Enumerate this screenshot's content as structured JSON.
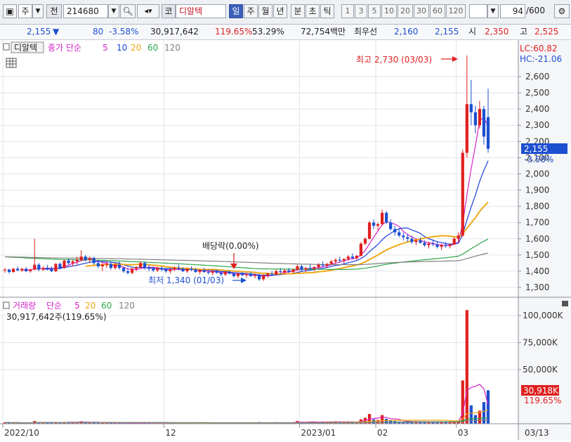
{
  "toolbar": {
    "period_label": "주",
    "jeon_label": "전",
    "code": "214680",
    "market_badge": "코",
    "stock_name": "디알텍",
    "period_tabs": [
      "일",
      "주",
      "월",
      "년",
      "분",
      "초",
      "틱"
    ],
    "active_tab": "일",
    "numbers": [
      "1",
      "3",
      "5",
      "10",
      "20",
      "30",
      "60",
      "120"
    ],
    "count_value": "94",
    "count_total": "/600",
    "icons": [
      "window-icon",
      "dropdown-icon",
      "search-icon",
      "speaker-icon",
      "chart-settings-icon"
    ]
  },
  "info": {
    "price": "2,155",
    "change_arrow": "▼",
    "change": "80",
    "change_rate": "-3.58%",
    "volume": "30,917,642",
    "volume_rate": "119.65%",
    "turnover": "53.29%",
    "amount": "72,754백만",
    "best_label": "최우선",
    "best_ask": "2,160",
    "best_bid": "2,155",
    "open_label": "시",
    "open": "2,350",
    "high_label": "고",
    "high": "2,525"
  },
  "price_panel": {
    "name_tag": "디알텍",
    "legend_prefix": "종가 단순",
    "ma_labels": [
      "5",
      "10",
      "20",
      "60",
      "120"
    ],
    "ma_colors": [
      "#d622c8",
      "#1a3fd6",
      "#f0a818",
      "#2ea64a",
      "#808080"
    ],
    "lc": "LC:60.82",
    "hc": "HC:-21.06",
    "high_annotation": "최고 2,730 (03/03)",
    "low_annotation": "최저 1,340 (01/03)",
    "dividend_annotation": "배당락(0.00%)",
    "current_price_tag": "2,155",
    "current_change_tag": "-3.58%"
  },
  "volume_panel": {
    "legend_title": "거래량",
    "legend_prefix": "단순",
    "ma_labels": [
      "5",
      "20",
      "60",
      "120"
    ],
    "ma_colors": [
      "#d622c8",
      "#f0a818",
      "#2ea64a",
      "#808080"
    ],
    "sub_label": "30,917,642주(119.65%)",
    "current_volume_tag": "30,918K",
    "current_rate_tag": "119.65%"
  },
  "x_axis": {
    "labels": [
      "2022/10",
      "12",
      "2023/01",
      "02",
      "03",
      "03/13"
    ]
  },
  "chart_data": {
    "type": "candlestick",
    "price_axis": {
      "ylim": [
        1250,
        2780
      ],
      "ticks": [
        1300,
        1400,
        1500,
        1600,
        1700,
        1800,
        1900,
        2000,
        2100,
        2200,
        2300,
        2400,
        2500,
        2600
      ]
    },
    "volume_axis": {
      "ylim": [
        0,
        110000
      ],
      "ticks": [
        "100,000K",
        "75,000K",
        "50,000K"
      ],
      "tick_values": [
        100000,
        75000,
        50000
      ]
    },
    "candles": [
      [
        1405,
        1420,
        1390,
        1410
      ],
      [
        1410,
        1415,
        1385,
        1395
      ],
      [
        1395,
        1420,
        1390,
        1415
      ],
      [
        1415,
        1430,
        1400,
        1405
      ],
      [
        1405,
        1420,
        1395,
        1415
      ],
      [
        1415,
        1425,
        1395,
        1400
      ],
      [
        1400,
        1415,
        1390,
        1410
      ],
      [
        1410,
        1600,
        1405,
        1440
      ],
      [
        1440,
        1450,
        1400,
        1410
      ],
      [
        1410,
        1430,
        1400,
        1420
      ],
      [
        1420,
        1440,
        1405,
        1415
      ],
      [
        1415,
        1430,
        1395,
        1400
      ],
      [
        1400,
        1450,
        1395,
        1445
      ],
      [
        1445,
        1455,
        1410,
        1420
      ],
      [
        1420,
        1470,
        1415,
        1465
      ],
      [
        1465,
        1480,
        1440,
        1450
      ],
      [
        1450,
        1470,
        1430,
        1460
      ],
      [
        1460,
        1490,
        1440,
        1470
      ],
      [
        1470,
        1530,
        1460,
        1490
      ],
      [
        1490,
        1500,
        1460,
        1470
      ],
      [
        1470,
        1490,
        1450,
        1480
      ],
      [
        1480,
        1490,
        1440,
        1450
      ],
      [
        1450,
        1470,
        1420,
        1430
      ],
      [
        1430,
        1450,
        1400,
        1440
      ],
      [
        1440,
        1460,
        1420,
        1445
      ],
      [
        1445,
        1460,
        1410,
        1420
      ],
      [
        1420,
        1450,
        1410,
        1440
      ],
      [
        1440,
        1460,
        1410,
        1420
      ],
      [
        1420,
        1430,
        1390,
        1400
      ],
      [
        1400,
        1420,
        1380,
        1390
      ],
      [
        1390,
        1420,
        1380,
        1415
      ],
      [
        1415,
        1430,
        1400,
        1425
      ],
      [
        1425,
        1460,
        1415,
        1450
      ],
      [
        1450,
        1460,
        1410,
        1420
      ],
      [
        1420,
        1440,
        1400,
        1415
      ],
      [
        1415,
        1430,
        1395,
        1405
      ],
      [
        1405,
        1425,
        1395,
        1420
      ],
      [
        1420,
        1430,
        1400,
        1410
      ],
      [
        1410,
        1420,
        1390,
        1400
      ],
      [
        1400,
        1415,
        1385,
        1410
      ],
      [
        1410,
        1430,
        1400,
        1420
      ],
      [
        1420,
        1440,
        1405,
        1415
      ],
      [
        1415,
        1425,
        1395,
        1400
      ],
      [
        1400,
        1420,
        1390,
        1415
      ],
      [
        1415,
        1430,
        1400,
        1410
      ],
      [
        1410,
        1420,
        1390,
        1395
      ],
      [
        1395,
        1410,
        1380,
        1405
      ],
      [
        1405,
        1420,
        1390,
        1395
      ],
      [
        1395,
        1410,
        1380,
        1390
      ],
      [
        1390,
        1405,
        1375,
        1400
      ],
      [
        1400,
        1410,
        1385,
        1390
      ],
      [
        1390,
        1400,
        1370,
        1380
      ],
      [
        1380,
        1400,
        1370,
        1395
      ],
      [
        1395,
        1405,
        1380,
        1385
      ],
      [
        1385,
        1395,
        1360,
        1370
      ],
      [
        1370,
        1390,
        1355,
        1385
      ],
      [
        1385,
        1395,
        1370,
        1375
      ],
      [
        1375,
        1390,
        1360,
        1380
      ],
      [
        1380,
        1395,
        1365,
        1370
      ],
      [
        1370,
        1385,
        1355,
        1375
      ],
      [
        1375,
        1385,
        1340,
        1350
      ],
      [
        1350,
        1380,
        1340,
        1375
      ],
      [
        1375,
        1390,
        1360,
        1385
      ],
      [
        1385,
        1400,
        1370,
        1380
      ],
      [
        1380,
        1410,
        1375,
        1400
      ],
      [
        1400,
        1420,
        1385,
        1395
      ],
      [
        1395,
        1410,
        1380,
        1405
      ],
      [
        1405,
        1420,
        1390,
        1395
      ],
      [
        1395,
        1415,
        1385,
        1410
      ],
      [
        1410,
        1440,
        1405,
        1430
      ],
      [
        1430,
        1440,
        1400,
        1410
      ],
      [
        1410,
        1425,
        1395,
        1420
      ],
      [
        1420,
        1440,
        1410,
        1415
      ],
      [
        1415,
        1430,
        1400,
        1425
      ],
      [
        1425,
        1450,
        1415,
        1440
      ],
      [
        1440,
        1460,
        1425,
        1435
      ],
      [
        1435,
        1450,
        1420,
        1445
      ],
      [
        1445,
        1470,
        1435,
        1460
      ],
      [
        1460,
        1480,
        1445,
        1470
      ],
      [
        1470,
        1490,
        1455,
        1465
      ],
      [
        1465,
        1480,
        1450,
        1475
      ],
      [
        1475,
        1500,
        1465,
        1490
      ],
      [
        1490,
        1510,
        1475,
        1480
      ],
      [
        1480,
        1500,
        1470,
        1495
      ],
      [
        1495,
        1580,
        1490,
        1570
      ],
      [
        1570,
        1610,
        1560,
        1600
      ],
      [
        1600,
        1710,
        1595,
        1700
      ],
      [
        1700,
        1720,
        1660,
        1680
      ],
      [
        1680,
        1700,
        1650,
        1690
      ],
      [
        1690,
        1780,
        1680,
        1760
      ],
      [
        1760,
        1770,
        1690,
        1700
      ],
      [
        1700,
        1720,
        1650,
        1660
      ],
      [
        1660,
        1680,
        1620,
        1640
      ],
      [
        1640,
        1660,
        1610,
        1620
      ],
      [
        1620,
        1640,
        1590,
        1610
      ],
      [
        1610,
        1630,
        1580,
        1600
      ],
      [
        1600,
        1620,
        1570,
        1580
      ],
      [
        1580,
        1600,
        1560,
        1590
      ],
      [
        1590,
        1610,
        1570,
        1575
      ],
      [
        1575,
        1590,
        1550,
        1560
      ],
      [
        1560,
        1580,
        1540,
        1570
      ],
      [
        1570,
        1590,
        1555,
        1565
      ],
      [
        1565,
        1580,
        1540,
        1550
      ],
      [
        1550,
        1570,
        1530,
        1560
      ],
      [
        1560,
        1580,
        1545,
        1555
      ],
      [
        1555,
        1570,
        1540,
        1565
      ],
      [
        1565,
        1610,
        1560,
        1600
      ],
      [
        1600,
        1640,
        1580,
        1620
      ],
      [
        1620,
        2150,
        1610,
        2130
      ],
      [
        2130,
        2730,
        2100,
        2430
      ],
      [
        2430,
        2580,
        2300,
        2380
      ],
      [
        2380,
        2420,
        2250,
        2300
      ],
      [
        2300,
        2450,
        2280,
        2400
      ],
      [
        2400,
        2420,
        2180,
        2230
      ],
      [
        2350,
        2525,
        2130,
        2155
      ]
    ],
    "volumes": [
      1200,
      900,
      800,
      1000,
      700,
      600,
      800,
      2500,
      1200,
      800,
      700,
      900,
      1500,
      1100,
      1600,
      1300,
      1200,
      1400,
      2200,
      1400,
      1000,
      1200,
      900,
      800,
      1000,
      900,
      700,
      800,
      900,
      700,
      600,
      700,
      1100,
      900,
      800,
      700,
      600,
      800,
      700,
      600,
      700,
      800,
      600,
      700,
      800,
      600,
      500,
      700,
      600,
      500,
      600,
      700,
      500,
      600,
      700,
      500,
      600,
      500,
      600,
      500,
      1500,
      1000,
      800,
      900,
      1200,
      1000,
      900,
      1000,
      1100,
      2500,
      1500,
      1200,
      1800,
      1300,
      1600,
      2000,
      1400,
      1800,
      2200,
      1500,
      1400,
      2000,
      1500,
      1800,
      4000,
      5500,
      9000,
      4000,
      3500,
      8000,
      4500,
      3500,
      2500,
      2000,
      1800,
      2200,
      1800,
      2000,
      1500,
      1700,
      2000,
      1500,
      1800,
      1600,
      1500,
      1700,
      2500,
      3000,
      40000,
      105000,
      17000,
      8000,
      12000,
      20000,
      30918
    ],
    "moving_averages": {
      "5": {
        "start_index": 4
      },
      "10": {
        "start_index": 9
      },
      "20": {
        "start_index": 19
      },
      "60": {
        "start_index": 0
      },
      "120": {
        "start_index": 0
      }
    }
  }
}
